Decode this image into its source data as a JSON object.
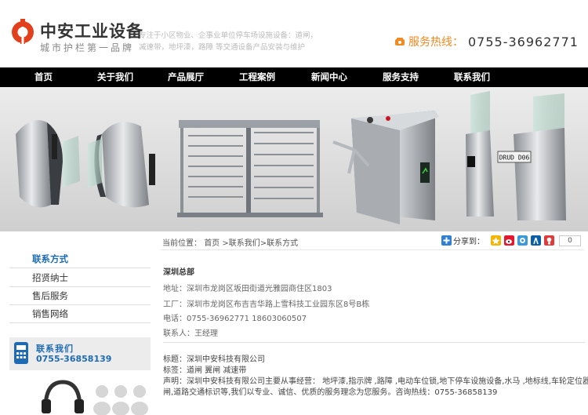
{
  "header": {
    "logo_title": "中安工业设备",
    "logo_subtitle": "城市护栏第一品牌",
    "tagline": "专注于小区物业、企事业单位停车场设施设备：道闸，减速带，地坪漆，路障 等交通设备产品安装与维护",
    "hotline_label": "服务热线：",
    "hotline_number": "0755-36962771"
  },
  "nav": [
    {
      "label": "首页"
    },
    {
      "label": "关于我们"
    },
    {
      "label": "产品展厅"
    },
    {
      "label": "工程案例"
    },
    {
      "label": "新闻中心"
    },
    {
      "label": "服务支持"
    },
    {
      "label": "联系我们"
    }
  ],
  "banner": {
    "plate_text": "DRUD D06"
  },
  "sidebar": {
    "items": [
      {
        "label": "联系方式"
      },
      {
        "label": "招贤纳士"
      },
      {
        "label": "售后服务"
      },
      {
        "label": "销售网络"
      }
    ],
    "contact_title": "联系我们",
    "contact_number": "0755-36858139"
  },
  "breadcrumb": {
    "prefix": "当前位置：",
    "home": "首页",
    "sep1": " >",
    "section": "联系我们",
    "sep2": ">",
    "current": "联系方式"
  },
  "share": {
    "label": "分享到：",
    "count": "0",
    "icons": [
      "qzone-icon",
      "weibo-icon",
      "tqq-icon",
      "renren-icon",
      "kaixin-icon"
    ]
  },
  "content": {
    "hq_title": "深圳总部",
    "address_label": "地址：",
    "address": "深圳市龙岗区坂田街道光雅园商住区1803",
    "factory_label": "工厂：",
    "factory": "深圳市龙岗区布吉吉华路上雪科技工业园东区8号B栋",
    "phone_label": "电话：",
    "phone": "0755-36962771   18603060507",
    "contact_label": "联系人：",
    "contact": "王经理",
    "company_label": "标题：",
    "company": "深圳中安科技有限公司",
    "tags_label": "标签：",
    "tags": "道闸 翼闸 减速带",
    "statement_label": "声明：",
    "statement_line1": "深圳中安科技有限公司主要从事经营： 地坪漆,指示牌 ,路障 ,电动车位锁,地下停车设施设备,水马 ,地标线,车轮定位器, 三辊",
    "statement_line2": "闸,道路交通标识等,我们以专业、诚信、优质的服务理念为您服务。咨询热线：0755-36858139"
  }
}
